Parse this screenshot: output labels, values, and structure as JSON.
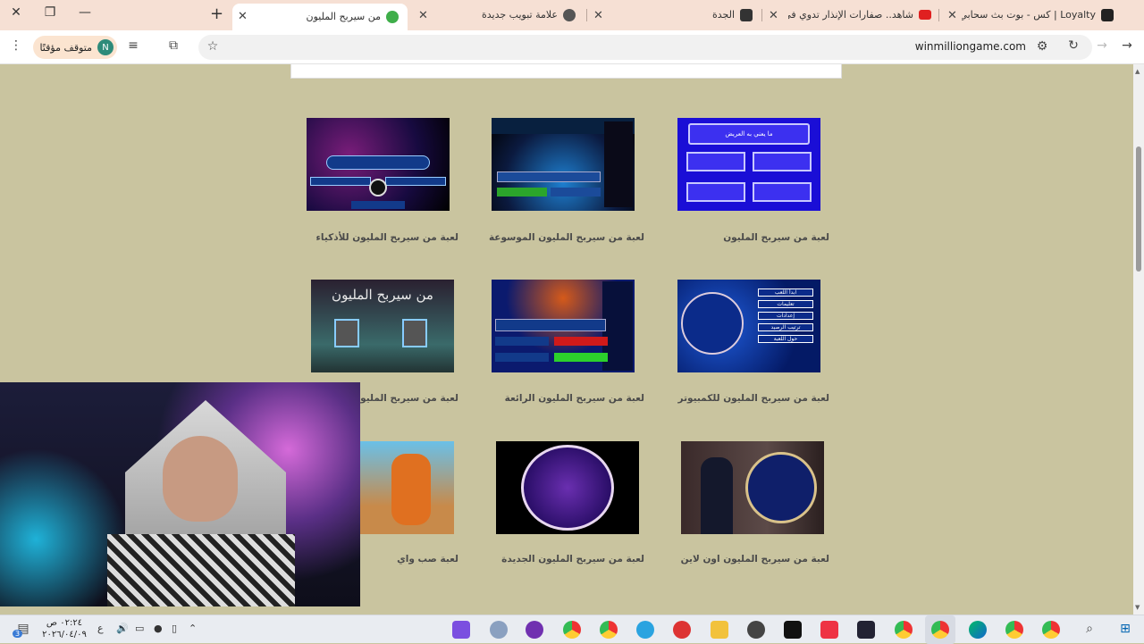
{
  "browser": {
    "tabs": [
      {
        "title": "من سيربح المليون",
        "active": true
      },
      {
        "title": "علامة تبويب جديدة",
        "active": false
      },
      {
        "title": "الجدة",
        "active": false
      },
      {
        "title": "شاهد.. صفارات الإنذار تدوي في تل",
        "active": false
      },
      {
        "title": "Loyalty | كس - بوت بث سحابي لـ",
        "active": false
      }
    ],
    "paused_label": "متوقف مؤقتًا",
    "avatar_letter": "N",
    "url": "winmilliongame.com"
  },
  "games": [
    {
      "title": "لعبة من سيربح المليون"
    },
    {
      "title": "لعبة من سيربح المليون الموسوعة"
    },
    {
      "title": "لعبة من سيربح المليون للأذكياء"
    },
    {
      "title": "لعبة من سيربح المليون للكمبيوتر"
    },
    {
      "title": "لعبة من سيربح المليون الرائعة"
    },
    {
      "title": "لعبة من سيربح المليون القديمة"
    },
    {
      "title": "لعبة من سيربح المليون اون لاين"
    },
    {
      "title": "لعبة من سيربح المليون الجديدة"
    },
    {
      "title": "لعبة صب واي"
    }
  ],
  "thumb_text": {
    "game1_question": "ما يعني به العريض",
    "game4_menu": [
      "ابدأ اللعب",
      "تعليمات",
      "إعدادات",
      "ترتيب الرصيد",
      "حول اللعبة"
    ],
    "game6_header": "من سيربح المليون"
  },
  "taskbar": {
    "time": "٠٢:٢٤ ص",
    "date": "٢٠٢٦/٠٤/٠٩",
    "lang": "ع",
    "badge": "3"
  }
}
